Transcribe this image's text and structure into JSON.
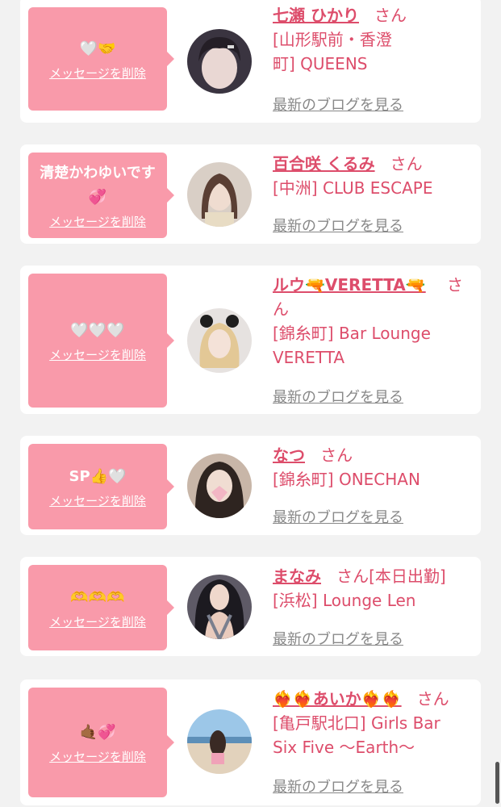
{
  "common": {
    "delete_label": "メッセージを削除",
    "blog_label": "最新のブログを見る"
  },
  "entries": [
    {
      "message": "🤍🤝",
      "name": "七瀬 ひかり",
      "suffix": "さん",
      "shop_line1": "[山形駅前・香澄",
      "shop_line2": "町] QUEENS"
    },
    {
      "message_line1": "清楚かわゆいです",
      "message_line2": "💞",
      "name": "百合咲 くるみ",
      "suffix": "さん",
      "shop_line1": "[中洲] CLUB ESCAPE"
    },
    {
      "message": "🤍🤍🤍",
      "name": "ルウ🔫VERETTA🔫",
      "suffix_line1": "さ",
      "suffix_line2": "ん",
      "shop_line1": "[錦糸町] Bar Lounge",
      "shop_line2": "VERETTA"
    },
    {
      "message": "SP👍🤍",
      "name": "なつ",
      "suffix": "さん",
      "shop_line1": "[錦糸町] ONECHAN"
    },
    {
      "message": "🫶🫶🫶",
      "name": "まなみ",
      "suffix": "さん[本日出勤]",
      "shop_line1": "[浜松] Lounge Len"
    },
    {
      "message": "🤙🏾💞",
      "name": "❤️‍🔥❤️‍🔥あいか❤️‍🔥❤️‍🔥",
      "suffix": "さん",
      "shop_line1": "[亀戸駅北口] Girls Bar",
      "shop_line2": "Six Five 〜Earth〜"
    }
  ]
}
